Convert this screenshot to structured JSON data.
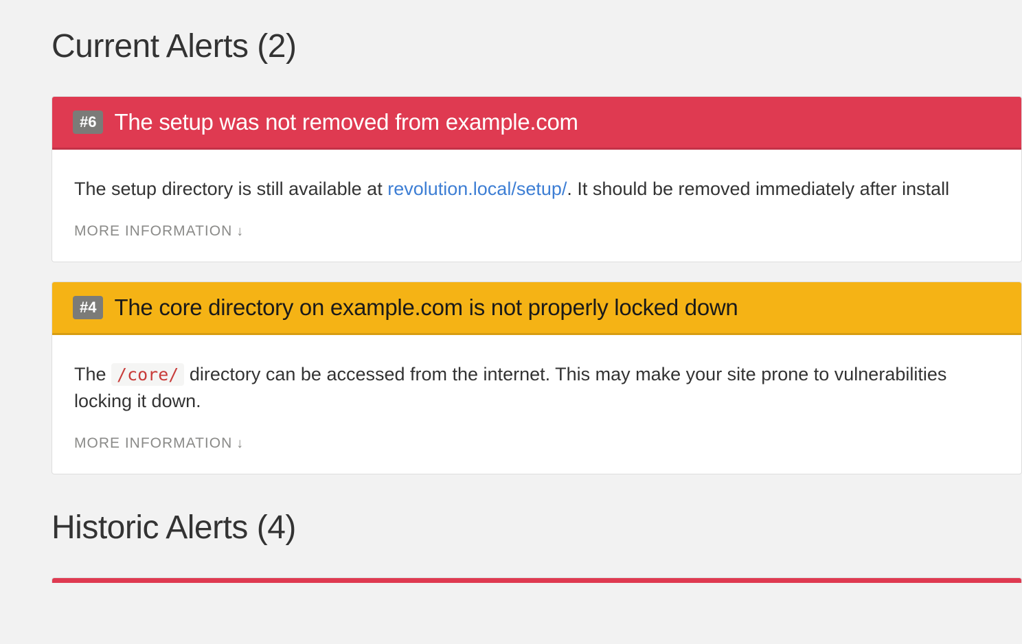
{
  "sections": {
    "current": {
      "heading": "Current Alerts (2)"
    },
    "historic": {
      "heading": "Historic Alerts (4)"
    }
  },
  "alerts": [
    {
      "id_badge": "#6",
      "severity": "danger",
      "title": "The setup was not removed from example.com",
      "body_pre": "The setup directory is still available at ",
      "body_link": "revolution.local/setup/",
      "body_post": ". It should be removed immediately after install",
      "more_info": "MORE INFORMATION"
    },
    {
      "id_badge": "#4",
      "severity": "warning",
      "title": "The core directory on example.com is not properly locked down",
      "body_pre": "The ",
      "body_code": "/core/",
      "body_mid": " directory can be accessed from the internet. This may make your site prone to vulnerabilities ",
      "body_post2": "locking it down.",
      "more_info": "MORE INFORMATION"
    }
  ],
  "arrow": "↓"
}
